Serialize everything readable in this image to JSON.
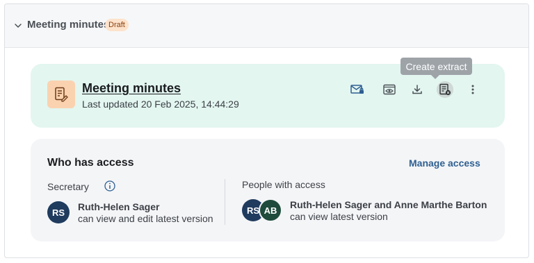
{
  "header": {
    "title": "Meeting minutes",
    "badge": "Draft"
  },
  "document": {
    "title": "Meeting minutes",
    "last_updated": "Last updated 20 Feb 2025, 14:44:29",
    "actions": [
      {
        "name": "email-lock-icon"
      },
      {
        "name": "preview-icon"
      },
      {
        "name": "download-icon"
      },
      {
        "name": "create-extract-icon"
      },
      {
        "name": "more-icon"
      }
    ],
    "tooltip": "Create extract"
  },
  "access": {
    "title": "Who has access",
    "manage_label": "Manage access",
    "secretary": {
      "label": "Secretary",
      "initials": "RS",
      "name": "Ruth-Helen Sager",
      "permission": "can view and edit latest version"
    },
    "people": {
      "label": "People with access",
      "initials": [
        "RS",
        "AB"
      ],
      "names": "Ruth-Helen Sager and Anne Marthe Barton",
      "permission": "can view latest version"
    }
  },
  "colors": {
    "accent": "#2e5f91",
    "doc_panel_bg": "#e3f6f0",
    "badge_bg": "#fde3cc",
    "avatar_navy": "#1f3b5e",
    "avatar_green": "#1e4b3b"
  }
}
